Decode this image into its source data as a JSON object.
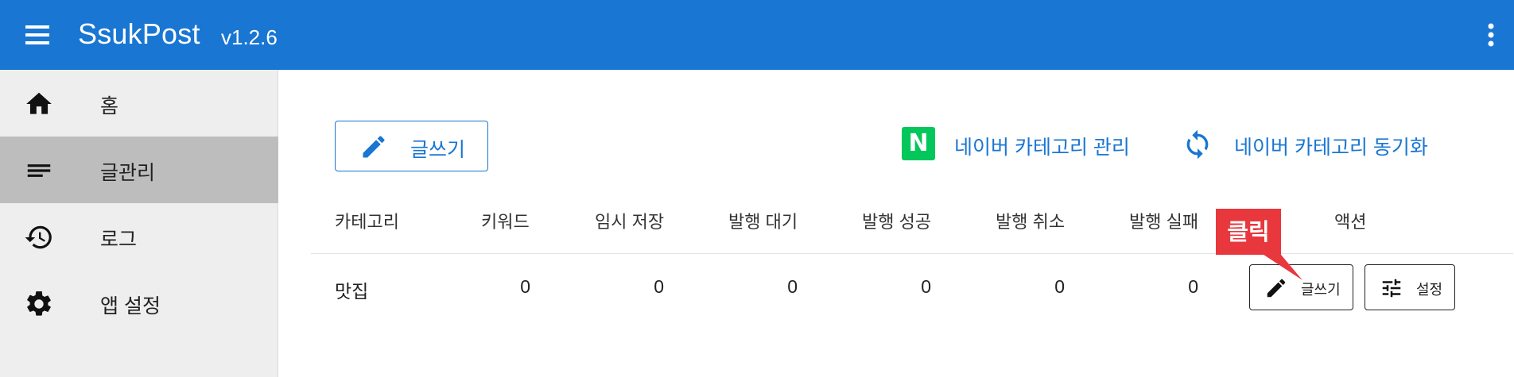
{
  "app": {
    "title": "SsukPost",
    "version": "v1.2.6",
    "menu_icon": "hamburger-menu-icon",
    "more_icon": "more-vert-icon"
  },
  "colors": {
    "primary": "#1976d2",
    "sidebar_bg": "#eeeeee",
    "active_item": "#bdbdbd",
    "naver_green": "#03c75a",
    "callout_red": "#e8383d"
  },
  "sidebar": {
    "items": [
      {
        "label": "홈",
        "icon": "home-icon",
        "active": false
      },
      {
        "label": "글관리",
        "icon": "list-icon",
        "active": true
      },
      {
        "label": "로그",
        "icon": "history-icon",
        "active": false
      },
      {
        "label": "앱 설정",
        "icon": "gear-icon",
        "active": false
      }
    ]
  },
  "toolbar": {
    "write_label": "글쓰기",
    "naver_logo_letter": "N",
    "category_manage_label": "네이버 카테고리 관리",
    "category_sync_label": "네이버 카테고리 동기화"
  },
  "table": {
    "headers": [
      "카테고리",
      "키워드",
      "임시 저장",
      "발행 대기",
      "발행 성공",
      "발행 취소",
      "발행 실패",
      "액션"
    ],
    "rows": [
      {
        "category": "맛집",
        "keyword": "0",
        "draft": "0",
        "pending": "0",
        "success": "0",
        "canceled": "0",
        "failed": "0",
        "write_label": "글쓰기",
        "settings_label": "설정"
      }
    ]
  },
  "callout": {
    "text": "클릭"
  }
}
